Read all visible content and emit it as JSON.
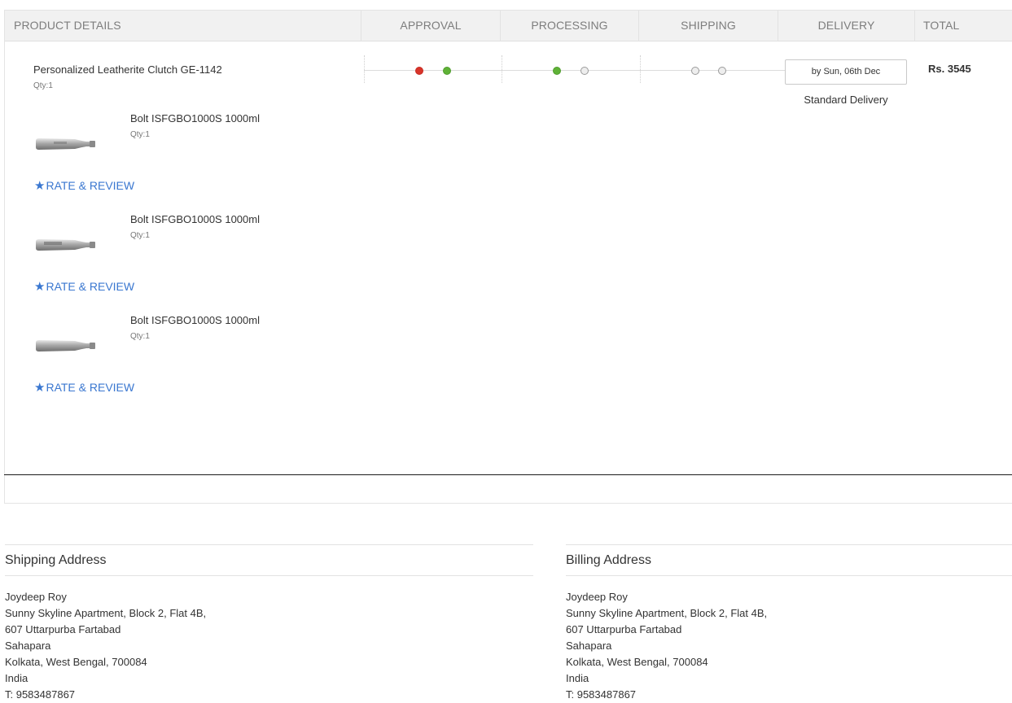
{
  "columns": {
    "product_details": "PRODUCT DETAILS",
    "approval": "APPROVAL",
    "processing": "PROCESSING",
    "shipping": "SHIPPING",
    "delivery": "DELIVERY",
    "total": "TOTAL"
  },
  "order": {
    "main_product": {
      "name": "Personalized Leatherite Clutch GE-1142",
      "qty": "Qty:1"
    },
    "delivery_date": "by Sun, 06th Dec",
    "delivery_type": "Standard Delivery",
    "total": "Rs. 3545",
    "tracking_colors": {
      "cancelled": "#d8342a",
      "done": "#5fb237",
      "pending": "#eeeeee"
    },
    "sub_items": [
      {
        "name": "Bolt ISFGBO1000S 1000ml",
        "qty": "Qty:1",
        "rate_label": "RATE & REVIEW"
      },
      {
        "name": "Bolt ISFGBO1000S 1000ml",
        "qty": "Qty:1",
        "rate_label": "RATE & REVIEW"
      },
      {
        "name": "Bolt ISFGBO1000S 1000ml",
        "qty": "Qty:1",
        "rate_label": "RATE & REVIEW"
      }
    ]
  },
  "shipping_address": {
    "title": "Shipping Address",
    "lines": [
      "Joydeep Roy",
      "Sunny Skyline Apartment, Block 2, Flat 4B,",
      "607 Uttarpurba Fartabad",
      "Sahapara",
      "Kolkata, West Bengal, 700084",
      "India",
      "T: 9583487867"
    ]
  },
  "billing_address": {
    "title": "Billing Address",
    "lines": [
      "Joydeep Roy",
      "Sunny Skyline Apartment, Block 2, Flat 4B,",
      "607 Uttarpurba Fartabad",
      "Sahapara",
      "Kolkata, West Bengal, 700084",
      "India",
      "T: 9583487867"
    ]
  }
}
